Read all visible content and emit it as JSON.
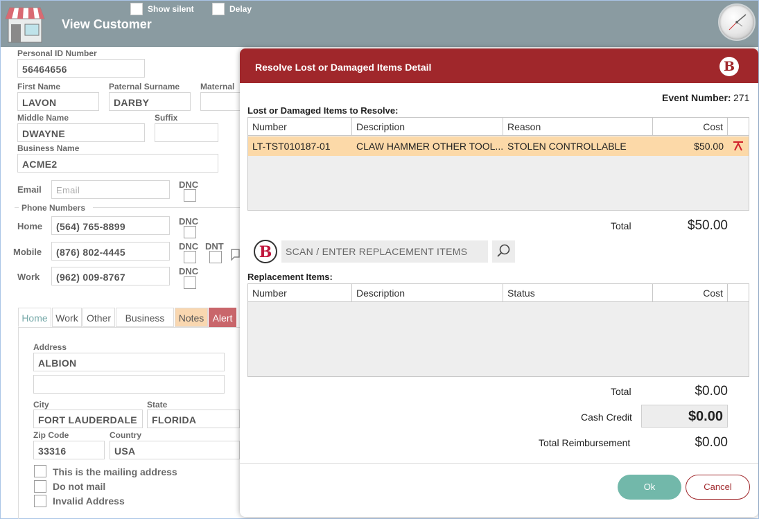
{
  "header": {
    "title": "View Customer",
    "show_silent_label": "Show silent",
    "delay_label": "Delay"
  },
  "customer": {
    "personal_id_label": "Personal ID Number",
    "personal_id": "56464656",
    "first_name_label": "First Name",
    "first_name": "LAVON",
    "paternal_surname_label": "Paternal Surname",
    "paternal_surname": "DARBY",
    "maternal_label": "Maternal",
    "middle_name_label": "Middle Name",
    "middle_name": "DWAYNE",
    "suffix_label": "Suffix",
    "business_name_label": "Business Name",
    "business_name": "ACME2",
    "email_label": "Email",
    "email_placeholder": "Email",
    "dnc_label": "DNC",
    "dnt_label": "DNT",
    "phone_numbers_label": "Phone Numbers",
    "phones": [
      {
        "label": "Home",
        "value": "(564) 765-8899"
      },
      {
        "label": "Mobile",
        "value": "(876) 802-4445"
      },
      {
        "label": "Work",
        "value": "(962) 009-8767"
      }
    ]
  },
  "tabs": [
    "Home",
    "Work",
    "Other",
    "Business",
    "Notes",
    "Alert"
  ],
  "address": {
    "address_label": "Address",
    "address1": "ALBION",
    "address2": "",
    "city_label": "City",
    "city": "FORT LAUDERDALE",
    "state_label": "State",
    "state": "FLORIDA",
    "zip_label": "Zip Code",
    "zip": "33316",
    "country_label": "Country",
    "country": "USA",
    "options": [
      "This is the mailing address",
      "Do not mail",
      "Invalid Address"
    ]
  },
  "modal": {
    "title": "Resolve Lost or Damaged Items Detail",
    "logo_letter": "B",
    "event_number_label": "Event Number:",
    "event_number": "271",
    "lost_section_label": "Lost or Damaged Items to Resolve:",
    "lost_columns": [
      "Number",
      "Description",
      "Reason",
      "Cost"
    ],
    "lost_rows": [
      {
        "number": "LT-TST010187-01",
        "description": "CLAW HAMMER OTHER TOOL...",
        "reason": "STOLEN CONTROLLABLE",
        "cost": "$50.00"
      }
    ],
    "lost_total_label": "Total",
    "lost_total": "$50.00",
    "scan_placeholder": "SCAN / ENTER REPLACEMENT ITEMS",
    "replacement_section_label": "Replacement Items:",
    "replacement_columns": [
      "Number",
      "Description",
      "Status",
      "Cost"
    ],
    "replacement_total_label": "Total",
    "replacement_total": "$0.00",
    "cash_credit_label": "Cash Credit",
    "cash_credit": "$0.00",
    "total_reimbursement_label": "Total Reimbursement",
    "total_reimbursement": "$0.00",
    "ok_label": "Ok",
    "cancel_label": "Cancel"
  },
  "colors": {
    "header_bg": "#8a9ba1",
    "modal_header": "#a0272b",
    "selected_row": "#fcd9a8",
    "ok_button": "#72b8aa"
  }
}
